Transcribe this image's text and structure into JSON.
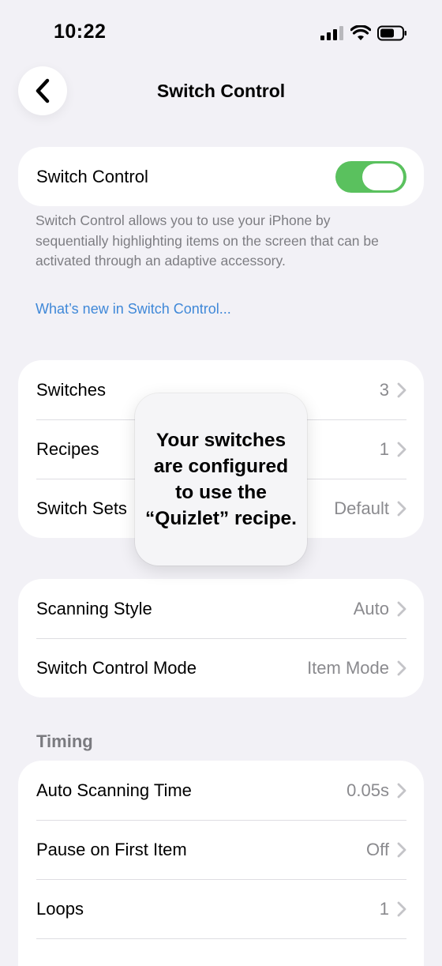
{
  "status_bar": {
    "time": "10:22"
  },
  "nav": {
    "back_icon": "chevron-left-icon",
    "title": "Switch Control"
  },
  "switch_control": {
    "label": "Switch Control",
    "enabled": true,
    "toggle_color": "#5ac15e",
    "description": "Switch Control allows you to use your iPhone by sequentially highlighting items on the screen that can be activated through an adaptive accessory.",
    "whats_new_link": "What’s new in Switch Control..."
  },
  "group1": [
    {
      "label": "Switches",
      "value": "3"
    },
    {
      "label": "Recipes",
      "value": "1"
    },
    {
      "label": "Switch Sets",
      "value": "Default"
    }
  ],
  "tooltip": {
    "text": "Your switches are configured to use the “Quizlet” recipe."
  },
  "group2": [
    {
      "label": "Scanning Style",
      "value": "Auto"
    },
    {
      "label": "Switch Control Mode",
      "value": "Item Mode"
    }
  ],
  "timing": {
    "header": "Timing",
    "rows": [
      {
        "label": "Auto Scanning Time",
        "value": "0.05s"
      },
      {
        "label": "Pause on First Item",
        "value": "Off"
      },
      {
        "label": "Loops",
        "value": "1"
      }
    ]
  },
  "colors": {
    "background": "#f2f1f6",
    "link": "#3f88d8",
    "secondary_text": "#8a8a8e"
  }
}
